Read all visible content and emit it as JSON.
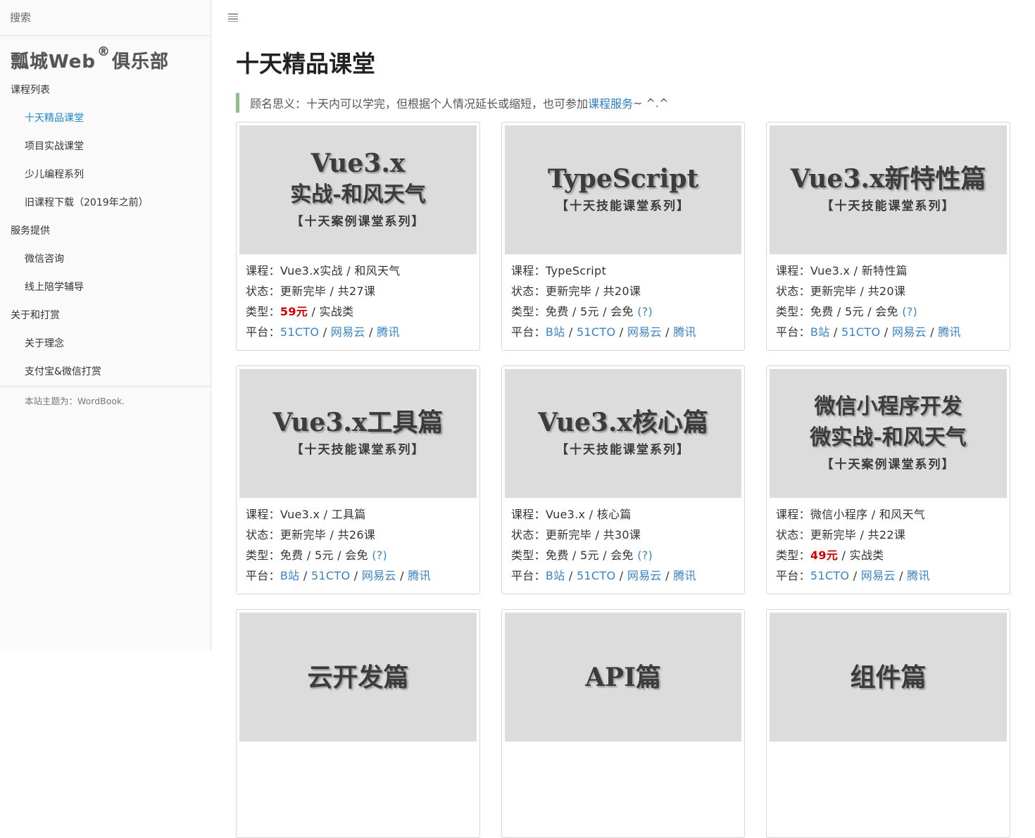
{
  "search": {
    "placeholder": "搜索"
  },
  "brand": {
    "name": "瓢城Web",
    "reg": "®",
    "suffix": "俱乐部"
  },
  "nav": [
    {
      "type": "group",
      "label": "课程列表"
    },
    {
      "type": "item",
      "label": "十天精品课堂",
      "active": true
    },
    {
      "type": "item",
      "label": "项目实战课堂"
    },
    {
      "type": "item",
      "label": "少儿编程系列"
    },
    {
      "type": "item",
      "label": "旧课程下载（2019年之前）"
    },
    {
      "type": "group",
      "label": "服务提供"
    },
    {
      "type": "item",
      "label": "微信咨询"
    },
    {
      "type": "item",
      "label": "线上陪学辅导"
    },
    {
      "type": "group",
      "label": "关于和打赏"
    },
    {
      "type": "item",
      "label": "关于理念"
    },
    {
      "type": "item",
      "label": "支付宝&微信打赏"
    }
  ],
  "footer": "本站主题为：WordBook.",
  "page": {
    "title": "十天精品课堂",
    "quote_prefix": "顾名思义：十天内可以学完，但根据个人情况延长或缩短，也可参加",
    "quote_link": "课程服务",
    "quote_suffix": "~ ^.^"
  },
  "labels": {
    "course": "课程：",
    "status": "状态：",
    "type": "类型：",
    "platform": "平台："
  },
  "cards": [
    {
      "thumb": [
        "Vue3.x",
        "实战-和风天气",
        "【十天案例课堂系列】"
      ],
      "course": "Vue3.x实战 / 和风天气",
      "status": "更新完毕 / 共27课",
      "price": "59元",
      "type_text": " / 实战类",
      "help": "",
      "platforms": [
        "51CTO",
        "网易云",
        "腾讯"
      ]
    },
    {
      "thumb": [
        "TypeScript",
        "",
        "【十天技能课堂系列】"
      ],
      "course": "TypeScript",
      "status": "更新完毕 / 共20课",
      "price": "",
      "type_text": "免费 / 5元 / 会免 ",
      "help": "(?)",
      "platforms": [
        "B站",
        "51CTO",
        "网易云",
        "腾讯"
      ]
    },
    {
      "thumb": [
        "Vue3.x新特性篇",
        "",
        "【十天技能课堂系列】"
      ],
      "course": "Vue3.x / 新特性篇",
      "status": "更新完毕 / 共20课",
      "price": "",
      "type_text": "免费 / 5元 / 会免 ",
      "help": "(?)",
      "platforms": [
        "B站",
        "51CTO",
        "网易云",
        "腾讯"
      ]
    },
    {
      "thumb": [
        "Vue3.x工具篇",
        "",
        "【十天技能课堂系列】"
      ],
      "course": "Vue3.x / 工具篇",
      "status": "更新完毕 / 共26课",
      "price": "",
      "type_text": "免费 / 5元 / 会免 ",
      "help": "(?)",
      "platforms": [
        "B站",
        "51CTO",
        "网易云",
        "腾讯"
      ]
    },
    {
      "thumb": [
        "Vue3.x核心篇",
        "",
        "【十天技能课堂系列】"
      ],
      "course": "Vue3.x / 核心篇",
      "status": "更新完毕 / 共30课",
      "price": "",
      "type_text": "免费 / 5元 / 会免 ",
      "help": "(?)",
      "platforms": [
        "B站",
        "51CTO",
        "网易云",
        "腾讯"
      ]
    },
    {
      "thumb": [
        "",
        "微信小程序开发\n微实战-和风天气",
        "【十天案例课堂系列】"
      ],
      "course": "微信小程序 / 和风天气",
      "status": "更新完毕 / 共22课",
      "price": "49元",
      "type_text": " / 实战类",
      "help": "",
      "platforms": [
        "51CTO",
        "网易云",
        "腾讯"
      ]
    },
    {
      "thumb": [
        "云开发篇",
        "",
        ""
      ]
    },
    {
      "thumb": [
        "API篇",
        "",
        ""
      ]
    },
    {
      "thumb": [
        "组件篇",
        "",
        ""
      ]
    }
  ]
}
